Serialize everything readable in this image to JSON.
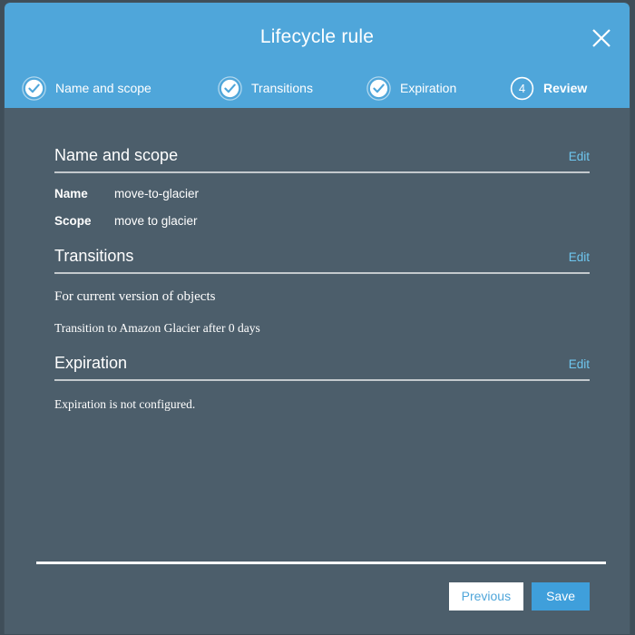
{
  "header": {
    "title": "Lifecycle rule",
    "close_icon": "close-icon",
    "steps": [
      {
        "label": "Name and scope",
        "state": "complete",
        "icon": "check-circle-icon",
        "number": "1"
      },
      {
        "label": "Transitions",
        "state": "complete",
        "icon": "check-circle-icon",
        "number": "2"
      },
      {
        "label": "Expiration",
        "state": "complete",
        "icon": "check-circle-icon",
        "number": "3"
      },
      {
        "label": "Review",
        "state": "current",
        "icon": "number-circle-icon",
        "number": "4"
      }
    ]
  },
  "sections": {
    "name_and_scope": {
      "title": "Name and scope",
      "edit_label": "Edit",
      "rows": [
        {
          "key": "Name",
          "value": "move-to-glacier"
        },
        {
          "key": "Scope",
          "value": "move to glacier"
        }
      ]
    },
    "transitions": {
      "title": "Transitions",
      "edit_label": "Edit",
      "line1": "For current version of objects",
      "line2": "Transition to  Amazon Glacier after 0 days"
    },
    "expiration": {
      "title": "Expiration",
      "edit_label": "Edit",
      "line1": "Expiration is not configured."
    }
  },
  "footer": {
    "previous_label": "Previous",
    "save_label": "Save"
  },
  "colors": {
    "header_blue": "#4fa6da",
    "body_slate": "#4c5e6b",
    "link_blue": "#6ec6ef",
    "primary_blue": "#3f9fdb",
    "divider_gray": "#c3c9cd",
    "white": "#ffffff"
  }
}
